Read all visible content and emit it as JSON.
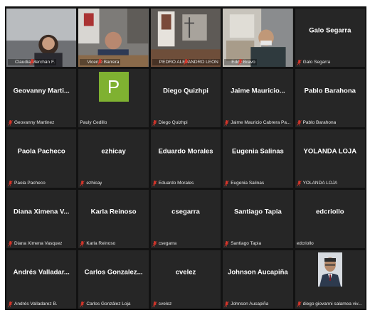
{
  "participants": [
    {
      "display": "",
      "label": "Claudia Merchán F.",
      "muted": true,
      "kind": "video"
    },
    {
      "display": "",
      "label": "Vicente Barrera",
      "muted": true,
      "kind": "video"
    },
    {
      "display": "",
      "label": "PEDRO ALEJANDRO LEON",
      "muted": true,
      "kind": "video"
    },
    {
      "display": "",
      "label": "Eddy Bravo",
      "muted": true,
      "kind": "video"
    },
    {
      "display": "Galo Segarra",
      "label": "Galo Segarra",
      "muted": true,
      "kind": "name"
    },
    {
      "display": "Geovanny Marti...",
      "label": "Geovanny Martinez",
      "muted": true,
      "kind": "name"
    },
    {
      "display": "",
      "avatar_letter": "P",
      "label": "Pauly Cedillo",
      "muted": false,
      "kind": "avatar"
    },
    {
      "display": "Diego Quizhpi",
      "label": "Diego Quizhpi",
      "muted": true,
      "kind": "name"
    },
    {
      "display": "Jaime Mauricio...",
      "label": "Jaime Mauricio Cabrera Pa...",
      "muted": true,
      "kind": "name"
    },
    {
      "display": "Pablo Barahona",
      "label": "Pablo Barahona",
      "muted": true,
      "kind": "name"
    },
    {
      "display": "Paola Pacheco",
      "label": "Paola Pacheco",
      "muted": true,
      "kind": "name"
    },
    {
      "display": "ezhicay",
      "label": "ezhicay",
      "muted": true,
      "kind": "name"
    },
    {
      "display": "Eduardo Morales",
      "label": "Eduardo Morales",
      "muted": true,
      "kind": "name"
    },
    {
      "display": "Eugenia Salinas",
      "label": "Eugenia Salinas",
      "muted": true,
      "kind": "name"
    },
    {
      "display": "YOLANDA LOJA",
      "label": "YOLANDA LOJA",
      "muted": true,
      "kind": "name"
    },
    {
      "display": "Diana Ximena V...",
      "label": "Diana Ximena Vasquez",
      "muted": true,
      "kind": "name"
    },
    {
      "display": "Karla Reinoso",
      "label": "Karla Reinoso",
      "muted": true,
      "kind": "name"
    },
    {
      "display": "csegarra",
      "label": "csegarra",
      "muted": true,
      "kind": "name"
    },
    {
      "display": "Santiago Tapia",
      "label": "Santiago Tapia",
      "muted": true,
      "kind": "name"
    },
    {
      "display": "edcriollo",
      "label": "edcriollo",
      "muted": false,
      "kind": "name"
    },
    {
      "display": "Andrés Valladar...",
      "label": "Andrés Valladarez B.",
      "muted": true,
      "kind": "name"
    },
    {
      "display": "Carlos Gonzalez...",
      "label": "Carlos González Loja",
      "muted": true,
      "kind": "name"
    },
    {
      "display": "cvelez",
      "label": "cvelez",
      "muted": true,
      "kind": "name"
    },
    {
      "display": "Johnson Aucapiña",
      "label": "Johnson Aucapiña",
      "muted": true,
      "kind": "name"
    },
    {
      "display": "",
      "label": "diego giovanni salamea viv...",
      "muted": true,
      "kind": "photo"
    }
  ],
  "colors": {
    "mute_icon": "#d9362b",
    "tile_bg": "#262626",
    "avatar_bg": "#7fb131"
  },
  "icons": {
    "mute": "mic-muted-icon"
  }
}
